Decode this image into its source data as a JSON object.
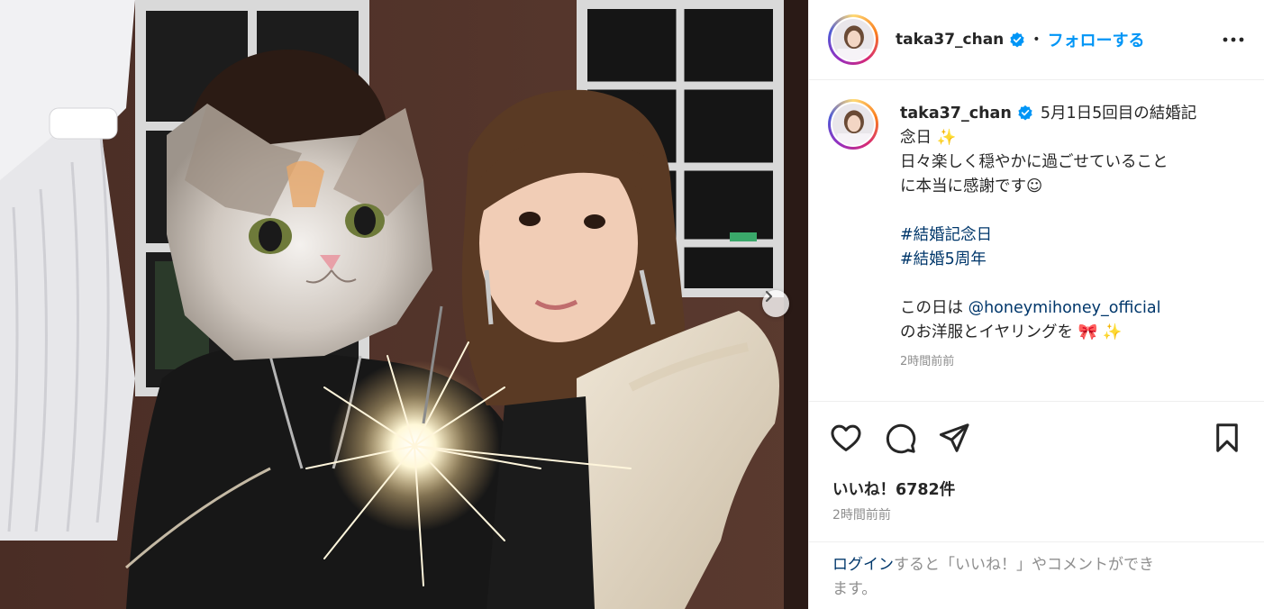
{
  "post": {
    "username": "taka37_chan",
    "separator": "•",
    "follow_label": "フォローする",
    "caption_lines": [
      "5月1日5回目の結婚記",
      "念日 ✨",
      "日々楽しく穏やかに過ごせていること",
      "に本当に感謝です☺"
    ],
    "hashtags": [
      "#結婚記念日",
      "#結婚5周年"
    ],
    "mention_prefix": "この日は ",
    "mention": "@honeymihoney_official",
    "mention_suffix": "のお洋服とイヤリングを 🎀 ✨",
    "caption_time": "2時間前前",
    "likes": "いいね！6782件",
    "post_time": "2時間前前",
    "login_link": "ログイン",
    "login_text_1": "すると「いいね！」やコメントができ",
    "login_text_2": "ます。"
  },
  "icons": {
    "verified": "verified-badge-icon",
    "more": "more-options-icon",
    "like": "heart-icon",
    "comment": "comment-icon",
    "share": "share-icon",
    "save": "bookmark-icon",
    "next": "chevron-right-icon"
  },
  "colors": {
    "follow": "#0095f6",
    "link": "#00376b",
    "muted": "#8e8e8e",
    "text": "#262626"
  }
}
